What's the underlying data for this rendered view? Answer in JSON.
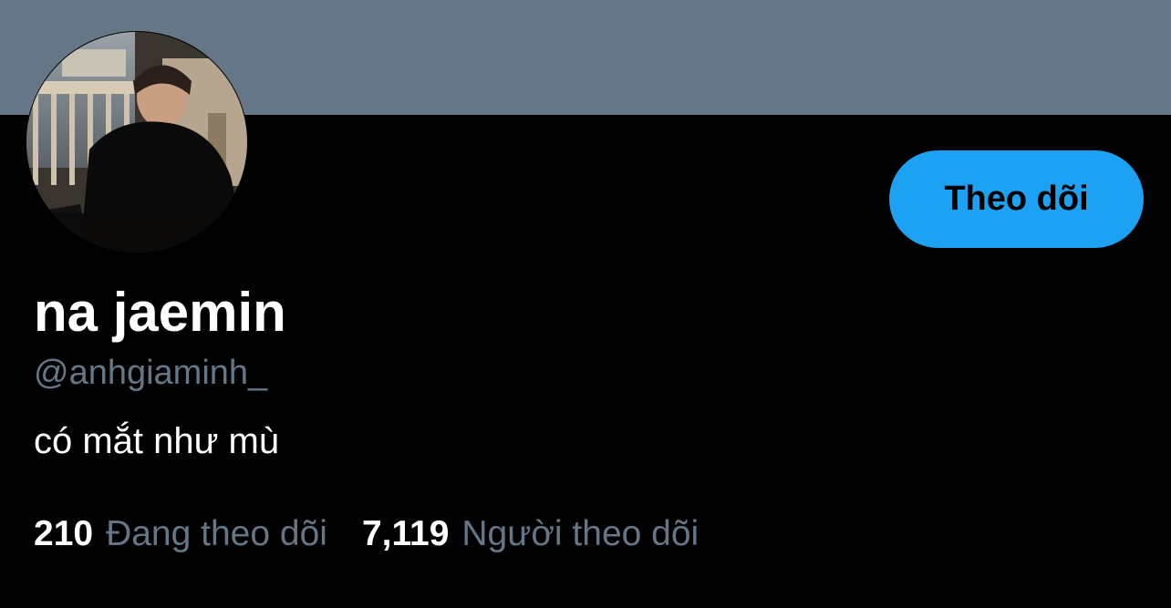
{
  "profile": {
    "display_name": "na jaemin",
    "handle": "@anhgiaminh_",
    "bio": "có mắt như mù"
  },
  "actions": {
    "follow_label": "Theo dõi"
  },
  "stats": {
    "following_count": "210",
    "following_label": "Đang theo dõi",
    "followers_count": "7,119",
    "followers_label": "Người theo dõi"
  },
  "colors": {
    "background": "#000000",
    "banner": "#657786",
    "accent": "#1da1f2",
    "secondary_text": "#657786"
  }
}
